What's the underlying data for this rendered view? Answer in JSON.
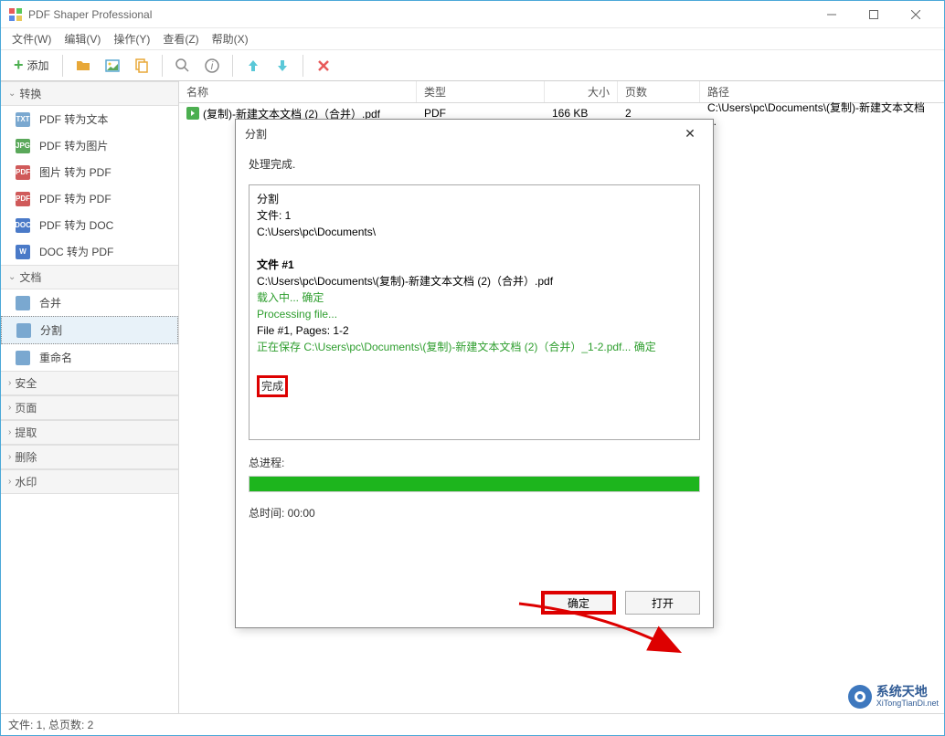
{
  "window": {
    "title": "PDF Shaper Professional"
  },
  "menu": {
    "file": "文件(W)",
    "edit": "编辑(V)",
    "action": "操作(Y)",
    "view": "查看(Z)",
    "help": "帮助(X)"
  },
  "toolbar": {
    "add": "添加"
  },
  "sidebar": {
    "cat_convert": "转换",
    "items_convert": [
      {
        "label": "PDF 转为文本",
        "icon": "TXT",
        "color": "#7aa8d0"
      },
      {
        "label": "PDF 转为图片",
        "icon": "JPG",
        "color": "#5aa85a"
      },
      {
        "label": "图片 转为 PDF",
        "icon": "PDF",
        "color": "#d05a5a"
      },
      {
        "label": "PDF 转为 PDF",
        "icon": "PDF",
        "color": "#d05a5a"
      },
      {
        "label": "PDF 转为 DOC",
        "icon": "DOC",
        "color": "#4a7ac8"
      },
      {
        "label": "DOC 转为 PDF",
        "icon": "W",
        "color": "#4a7ac8"
      }
    ],
    "cat_document": "文档",
    "items_document": [
      {
        "label": "合并",
        "icon": "",
        "color": "#7aa8d0"
      },
      {
        "label": "分割",
        "icon": "",
        "color": "#7aa8d0",
        "selected": true
      },
      {
        "label": "重命名",
        "icon": "",
        "color": "#7aa8d0"
      }
    ],
    "cat_security": "安全",
    "cat_page": "页面",
    "cat_extract": "提取",
    "cat_delete": "删除",
    "cat_watermark": "水印"
  },
  "columns": {
    "name": "名称",
    "type": "类型",
    "size": "大小",
    "pages": "页数",
    "path": "路径"
  },
  "files": [
    {
      "name": "(复制)-新建文本文档 (2)（合并）.pdf",
      "type": "PDF",
      "size": "166 KB",
      "pages": "2",
      "path": "C:\\Users\\pc\\Documents\\(复制)-新建文本文档 ..."
    }
  ],
  "dialog": {
    "title": "分割",
    "status": "处理完成.",
    "log": {
      "l1": "分割",
      "l2": "文件: 1",
      "l3": "C:\\Users\\pc\\Documents\\",
      "h1": "文件 #1",
      "l4": "C:\\Users\\pc\\Documents\\(复制)-新建文本文档 (2)（合并）.pdf",
      "l5": "载入中... 确定",
      "l6": "Processing file...",
      "l7": "File #1, Pages: 1-2",
      "l8": "正在保存 C:\\Users\\pc\\Documents\\(复制)-新建文本文档 (2)（合并）_1-2.pdf... 确定",
      "done": "完成"
    },
    "progress_label": "总进程:",
    "time_label": "总时间: 00:00",
    "btn_ok": "确定",
    "btn_open": "打开"
  },
  "statusbar": {
    "text": "文件: 1, 总页数: 2"
  },
  "watermark": {
    "cn": "系统天地",
    "en": "XiTongTianDi.net"
  }
}
